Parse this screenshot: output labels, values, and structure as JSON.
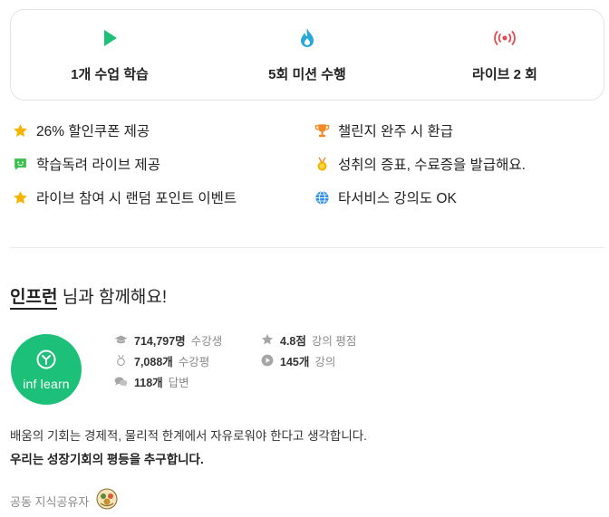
{
  "stats": [
    {
      "icon": "play-icon",
      "label": "1개 수업 학습",
      "color": "#1dc078"
    },
    {
      "icon": "flame-icon",
      "label": "5회 미션 수행",
      "color": "#29a9d8"
    },
    {
      "icon": "live-broadcast-icon",
      "label": "라이브 2 회",
      "color": "#e5484d"
    }
  ],
  "benefits": [
    {
      "icon": "star-icon",
      "text": "26% 할인쿠폰 제공"
    },
    {
      "icon": "trophy-icon",
      "text": "챌린지 완주 시 환급"
    },
    {
      "icon": "chat-icon",
      "text": "학습독려 라이브 제공"
    },
    {
      "icon": "medal-icon",
      "text": "성취의 증표, 수료증을 발급해요."
    },
    {
      "icon": "star-icon",
      "text": "라이브 참여 시 랜덤 포인트 이벤트"
    },
    {
      "icon": "globe-icon",
      "text": "타서비스 강의도 OK"
    }
  ],
  "instructor": {
    "name": "인프런",
    "suffix": " 님과 함께해요!",
    "logo_text": "inf learn",
    "stats": [
      {
        "icon": "graduation-cap-icon",
        "value": "714,797명",
        "label": "수강생"
      },
      {
        "icon": "star-icon",
        "value": "4.8점",
        "label": "강의 평점"
      },
      {
        "icon": "medal-icon",
        "value": "7,088개",
        "label": "수강평"
      },
      {
        "icon": "play-circle-icon",
        "value": "145개",
        "label": "강의"
      },
      {
        "icon": "chat-bubbles-icon",
        "value": "118개",
        "label": "답변"
      }
    ],
    "description_line1": "배움의 기회는 경제적, 물리적 한계에서 자유로워야 한다고 생각합니다.",
    "description_line2": "우리는 성장기회의 평등을 추구합니다.",
    "co_sharer_label": "공동 지식공유자"
  },
  "colors": {
    "brand_green": "#1dc078",
    "star_yellow": "#f5b400",
    "trophy_orange": "#f08a24",
    "globe_blue": "#2f8ee8"
  }
}
